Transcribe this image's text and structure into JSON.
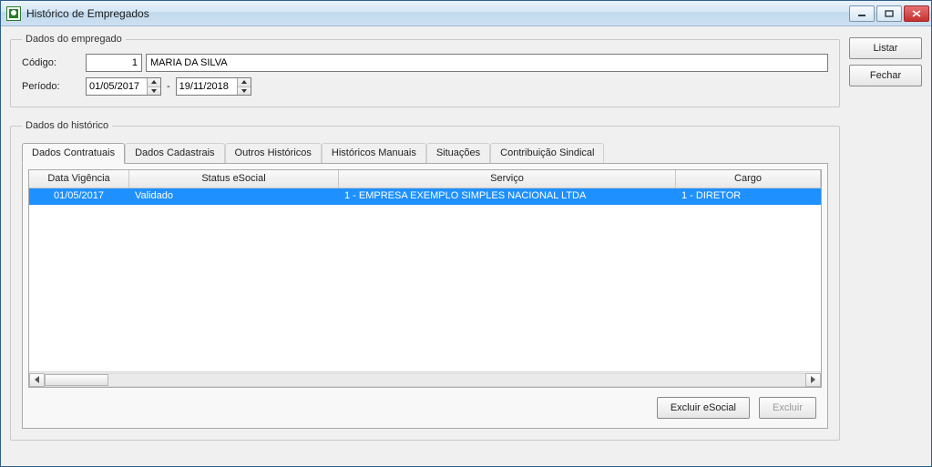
{
  "window": {
    "title": "Histórico de Empregados"
  },
  "sideButtons": {
    "listar": "Listar",
    "fechar": "Fechar"
  },
  "empregado": {
    "legend": "Dados do empregado",
    "codigoLabel": "Código:",
    "codigo": "1",
    "nome": "MARIA DA SILVA",
    "periodoLabel": "Período:",
    "periodoInicio": "01/05/2017",
    "periodoSep": "-",
    "periodoFim": "19/11/2018"
  },
  "historico": {
    "legend": "Dados do histórico",
    "tabs": [
      "Dados Contratuais",
      "Dados Cadastrais",
      "Outros Históricos",
      "Históricos Manuais",
      "Situações",
      "Contribuição Sindical"
    ],
    "activeTab": 0,
    "columns": {
      "vigencia": "Data Vigência",
      "status": "Status eSocial",
      "servico": "Serviço",
      "cargo": "Cargo"
    },
    "rows": [
      {
        "vigencia": "01/05/2017",
        "status": "Validado",
        "servico": "1 - EMPRESA EXEMPLO SIMPLES NACIONAL LTDA",
        "cargo": "1 - DIRETOR"
      }
    ],
    "buttons": {
      "excluirEsocial": "Excluir eSocial",
      "excluir": "Excluir"
    }
  }
}
